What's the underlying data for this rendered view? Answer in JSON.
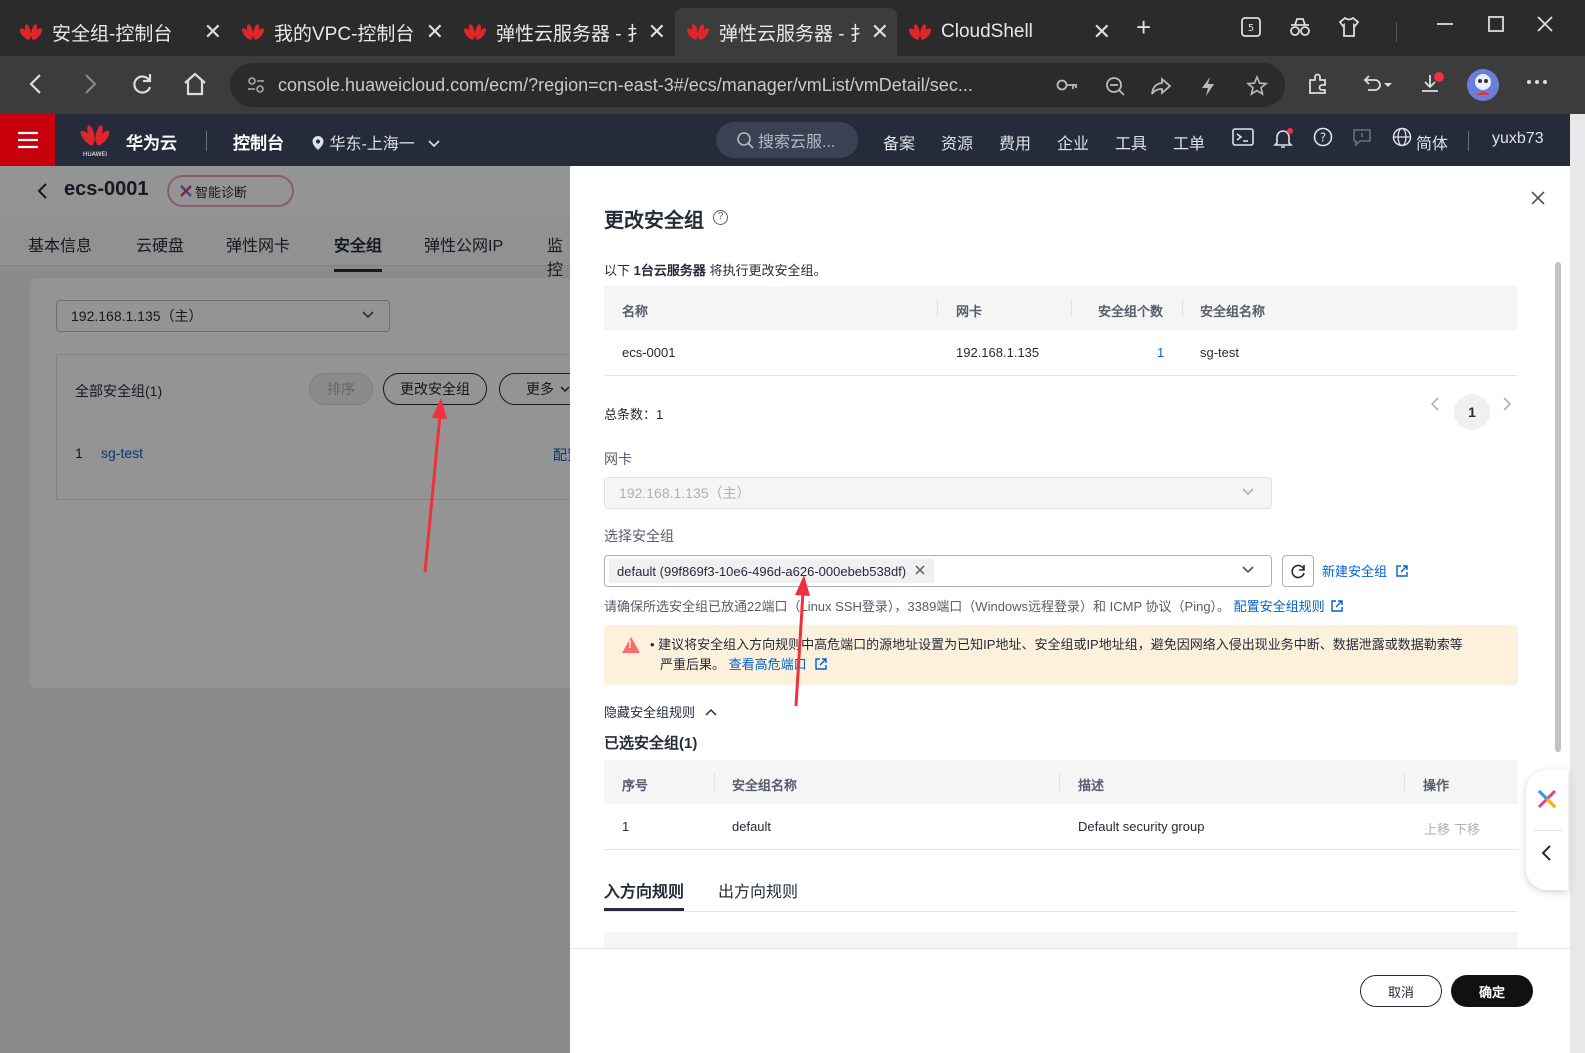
{
  "browser": {
    "tabs": [
      {
        "title": "安全组-控制台",
        "close": "✕"
      },
      {
        "title": "我的VPC-控制台",
        "close": "✕"
      },
      {
        "title": "弹性云服务器 - 扌",
        "close": "✕"
      },
      {
        "title": "弹性云服务器 - 扌",
        "close": "✕",
        "active": true
      },
      {
        "title": "CloudShell",
        "close": "✕"
      }
    ],
    "new_tab": "+",
    "url": "console.huaweicloud.com/ecm/?region=cn-east-3#/ecs/manager/vmList/vmDetail/sec..."
  },
  "console_header": {
    "brand": "华为云",
    "logo_text": "HUAWEI",
    "console": "控制台",
    "region": "华东-上海一",
    "search_placeholder": "搜索云服...",
    "links": [
      "备案",
      "资源",
      "费用",
      "企业",
      "工具",
      "工单"
    ],
    "language": "简体",
    "user": "yuxb73"
  },
  "background_page": {
    "instance_name": "ecs-0001",
    "diag_button": "智能诊断",
    "tabs": [
      "基本信息",
      "云硬盘",
      "弹性网卡",
      "安全组",
      "弹性公网IP",
      "监控"
    ],
    "active_tab": "安全组",
    "nic_select": "192.168.1.135（主）",
    "all_sg_label": "全部安全组(1)",
    "sort_button": "排序",
    "change_sg_button": "更改安全组",
    "more_button": "更多",
    "row": {
      "index": "1",
      "name": "sg-test",
      "action": "配置"
    }
  },
  "drawer": {
    "title": "更改安全组",
    "help_icon": "?",
    "intro_prefix": "以下 ",
    "intro_bold": "1台云服务器",
    "intro_suffix": " 将执行更改安全组。",
    "server_table": {
      "headers": [
        "名称",
        "网卡",
        "安全组个数",
        "安全组名称"
      ],
      "rows": [
        [
          "ecs-0001",
          "192.168.1.135",
          "1",
          "sg-test"
        ]
      ]
    },
    "total": "总条数：1",
    "page": "1",
    "nic_label": "网卡",
    "nic_value": "192.168.1.135（主）",
    "select_sg_label": "选择安全组",
    "selected_chip": "default (99f869f3-10e6-496d-a626-000ebeb538df)",
    "new_sg_link": "新建安全组",
    "hint_text": "请确保所选安全组已放通22端口（Linux SSH登录），3389端口（Windows远程登录）和 ICMP 协议（Ping）。",
    "hint_link": "配置安全组规则",
    "warning_line1": "• 建议将安全组入方向规则中高危端口的源地址设置为已知IP地址、安全组或IP地址组，避免因网络入侵出现业务中断、数据泄露或数据勒索等",
    "warning_line2_prefix": "严重后果。",
    "warning_link": "查看高危端口",
    "toggle_rules": "隐藏安全组规则",
    "selected_title": "已选安全组(1)",
    "selected_table": {
      "headers": [
        "序号",
        "安全组名称",
        "描述",
        "操作"
      ],
      "rows": [
        {
          "index": "1",
          "name": "default",
          "desc": "Default security group",
          "up": "上移",
          "down": "下移"
        }
      ]
    },
    "rule_tabs": [
      "入方向规则",
      "出方向规则"
    ],
    "cancel": "取消",
    "confirm": "确定"
  },
  "colors": {
    "accent_red": "#c7000b",
    "link_blue": "#0062d1",
    "header_dark": "#252b3a",
    "warn_bg": "#fdf0dc",
    "annotation_arrow": "#f0303a"
  }
}
